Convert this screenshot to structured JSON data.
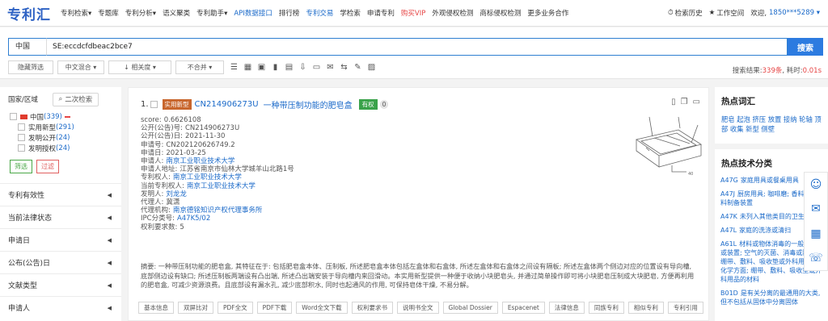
{
  "brand": {
    "logo": "专利汇"
  },
  "nav": [
    {
      "label": "专利检索▾",
      "style": ""
    },
    {
      "label": "专题库",
      "style": ""
    },
    {
      "label": "专利分析▾",
      "style": ""
    },
    {
      "label": "语义聚类",
      "style": ""
    },
    {
      "label": "专利助手▾",
      "style": ""
    },
    {
      "label": "API数据接口",
      "style": "blue"
    },
    {
      "label": "排行榜",
      "style": ""
    },
    {
      "label": "专利交易",
      "style": "blue"
    },
    {
      "label": "学检索",
      "style": ""
    },
    {
      "label": "申请专利",
      "style": ""
    },
    {
      "label": "购买VIP",
      "style": "red"
    },
    {
      "label": "外观侵权检测",
      "style": ""
    },
    {
      "label": "商标侵权检测",
      "style": ""
    },
    {
      "label": "更多业务合作",
      "style": ""
    }
  ],
  "nav_right": {
    "history": "检索历史",
    "workspace": "工作空间",
    "welcome": "欢迎,",
    "user": "1850***5289 ▾"
  },
  "search": {
    "country": "中国",
    "query": "SE:eccdcfdbeac2bce7",
    "button": "搜索"
  },
  "toolbar": {
    "hide_filter": "隐藏筛选",
    "merge": "中文混合 ▾",
    "sort": "↓ 相关度 ▾",
    "combine": "不合并 ▾"
  },
  "result": {
    "label": "搜索结果:",
    "count": "339条",
    "sep": ", 耗时:",
    "time": "0.01s"
  },
  "left": {
    "region_label": "国家/区域",
    "second_search": "二次检索",
    "tree": [
      {
        "label": "中国",
        "count": "(339)",
        "indent": 0,
        "flag": true
      },
      {
        "label": "实用新型",
        "count": "(291)",
        "indent": 1,
        "flag": false
      },
      {
        "label": "发明公开",
        "count": "(24)",
        "indent": 1,
        "flag": false
      },
      {
        "label": "发明授权",
        "count": "(24)",
        "indent": 1,
        "flag": false
      }
    ],
    "filter": "筛选",
    "exclude": "过滤",
    "facets": [
      "专利有效性",
      "当前法律状态",
      "申请日",
      "公布(公告)日",
      "文献类型",
      "申请人"
    ]
  },
  "record": {
    "index": "1.",
    "type_tag": "实用新型",
    "pn": "CN214906273U",
    "title": "一种带压制功能的肥皂盒",
    "status": "有权",
    "cite_count": "0",
    "fields": [
      {
        "label": "score:",
        "value": "0.6626108",
        "link": false
      },
      {
        "label": "公开(公告)号:",
        "value": "CN214906273U",
        "link": false
      },
      {
        "label": "公开(公告)日:",
        "value": "2021-11-30",
        "link": false
      },
      {
        "label": "申请号:",
        "value": "CN202120626749.2",
        "link": false
      },
      {
        "label": "申请日:",
        "value": "2021-03-25",
        "link": false
      },
      {
        "label": "申请人:",
        "value": "南京工业职业技术大学",
        "link": true
      },
      {
        "label": "申请人地址:",
        "value": "江苏省南京市仙林大学城羊山北路1号",
        "link": false
      },
      {
        "label": "专利权人:",
        "value": "南京工业职业技术大学",
        "link": true
      },
      {
        "label": "当前专利权人:",
        "value": "南京工业职业技术大学",
        "link": true
      },
      {
        "label": "发明人:",
        "value": "刘龙龙",
        "link": true
      },
      {
        "label": "代理人:",
        "value": "冀潇",
        "link": false
      },
      {
        "label": "代理机构:",
        "value": "南京德铭知识产权代理事务所",
        "link": true
      },
      {
        "label": "IPC分类号:",
        "value": "A47K5/02",
        "link": true
      },
      {
        "label": "权利要求数:",
        "value": "5",
        "link": false
      }
    ],
    "abstract": "摘要: 一种带压制功能的肥皂盒, 其特征在于: 包括肥皂盒本体、压制板, 所述肥皂盒本体包括左盒体和右盒体, 所述左盒体和右盒体之间设有隔板; 所述左盒体两个侧边对应的位置设有导向槽, 底部侧边设有缺口; 所述压制板两端设有凸出端, 所述凸出端安装于导向槽内来回滑动。本实用新型提供一种便于收纳小块肥皂头, 并通过简单操作即可将小块肥皂压制成大块肥皂, 方便再利用的肥皂盒, 可减少资源浪费。且底部设有漏水孔, 减少底部积水, 同时也起通风的作用, 可保持皂体干燥, 不易分解。",
    "actions": [
      "基本信息",
      "双屏比对",
      "PDF全文",
      "PDF下载",
      "Word全文下载",
      "权利要求书",
      "说明书全文",
      "Global Dossier",
      "Espacenet",
      "法律信息",
      "同族专利",
      "相似专利",
      "专利引用"
    ]
  },
  "right": {
    "hot_words_title": "热点词汇",
    "hot_words": "肥皂 起泡 挤压 放置 接纳 轮轴 顶部 收集 新型 侧壁",
    "hot_tech_title": "热点技术分类",
    "hot_tech": [
      {
        "code": "A47G",
        "text": "家庭用具或餐桌用具"
      },
      {
        "code": "A47J",
        "text": "厨房用具; 咖啡磨; 香料磨; 饮料制备装置"
      },
      {
        "code": "A47K",
        "text": "未列入其他类目的卫生设备"
      },
      {
        "code": "A47L",
        "text": "家庭的洗涤或清扫"
      },
      {
        "code": "A61L",
        "text": "材料或物体消毒的一般方法或装置; 空气的灭菌、消毒或除臭; 绷带、敷料、吸收垫或外科用品的化学方面; 绷带、敷料、吸收垫或外科用品的材料"
      },
      {
        "code": "B01D",
        "text": "是有关分离的最通用的大类, 但不包括从固体中分离固体"
      }
    ]
  },
  "drawing_label": "40"
}
